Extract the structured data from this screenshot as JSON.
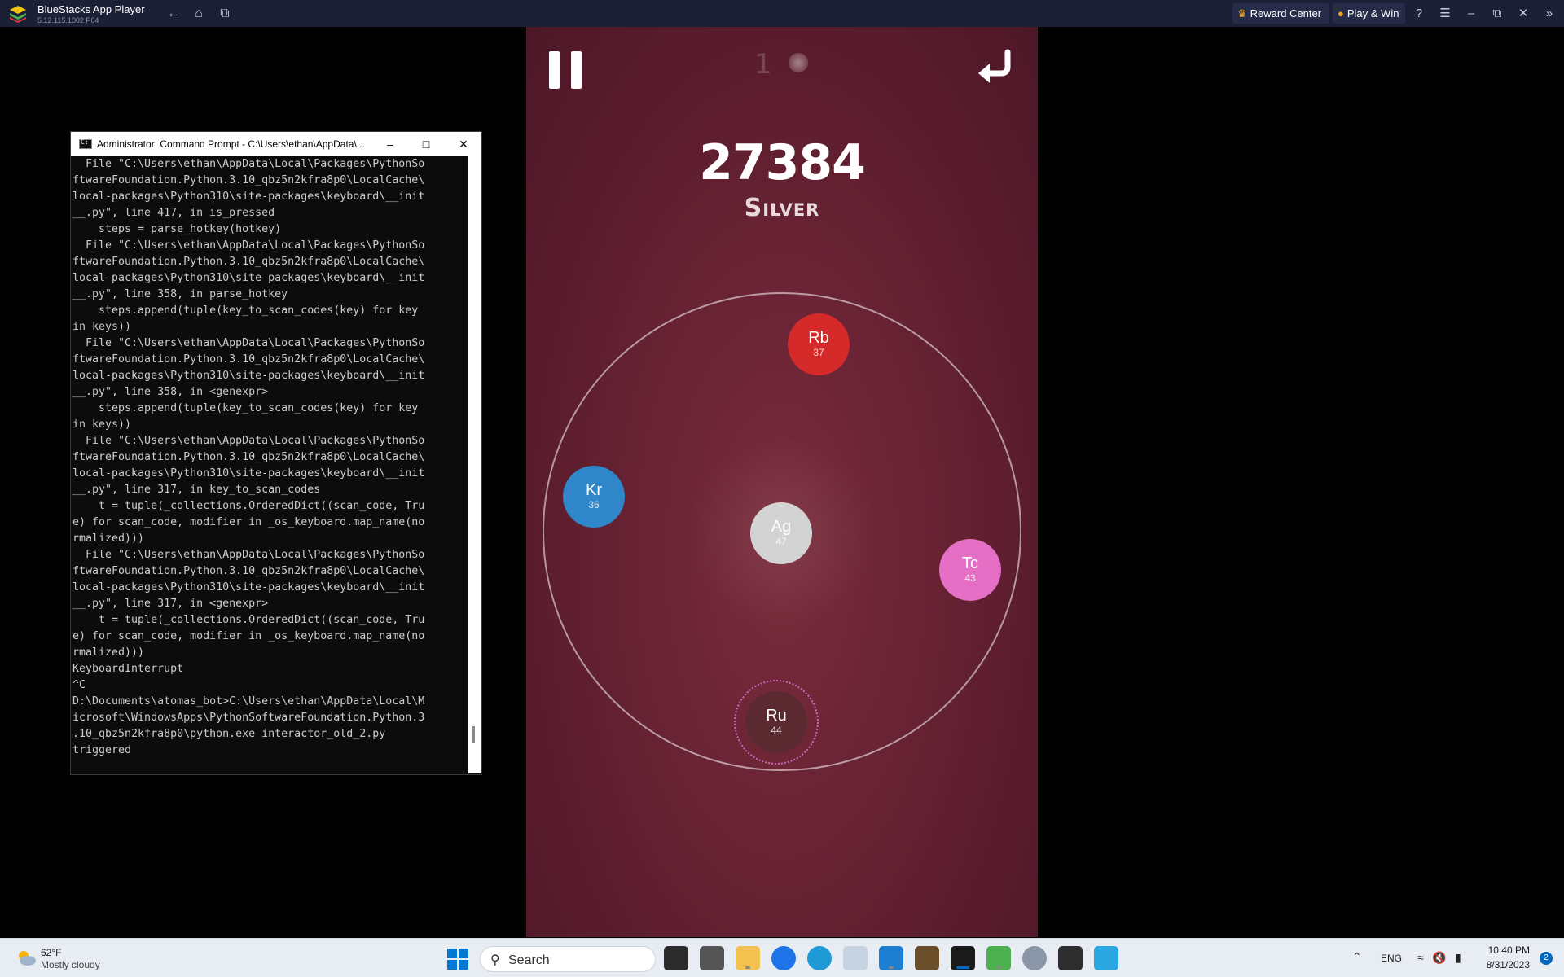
{
  "titlebar": {
    "app_title": "BlueStacks App Player",
    "version": "5.12.115.1002 P64",
    "reward_center": "Reward Center",
    "play_win": "Play & Win"
  },
  "game": {
    "level": "1",
    "score": "27384",
    "rank": "Silver",
    "atoms": [
      {
        "symbol": "Rb",
        "number": "37",
        "color": "#d42a2a"
      },
      {
        "symbol": "Kr",
        "number": "36",
        "color": "#2f86c8"
      },
      {
        "symbol": "Ag",
        "number": "47",
        "color": "#d3d3d3"
      },
      {
        "symbol": "Tc",
        "number": "43",
        "color": "#e56fc4"
      },
      {
        "symbol": "Ru",
        "number": "44",
        "color": "#5b2a30"
      }
    ]
  },
  "cmd": {
    "title": "Administrator: Command Prompt - C:\\Users\\ethan\\AppData\\...",
    "output": "  File \"C:\\Users\\ethan\\AppData\\Local\\Packages\\PythonSo\nftwareFoundation.Python.3.10_qbz5n2kfra8p0\\LocalCache\\\nlocal-packages\\Python310\\site-packages\\keyboard\\__init\n__.py\", line 417, in is_pressed\n    steps = parse_hotkey(hotkey)\n  File \"C:\\Users\\ethan\\AppData\\Local\\Packages\\PythonSo\nftwareFoundation.Python.3.10_qbz5n2kfra8p0\\LocalCache\\\nlocal-packages\\Python310\\site-packages\\keyboard\\__init\n__.py\", line 358, in parse_hotkey\n    steps.append(tuple(key_to_scan_codes(key) for key\nin keys))\n  File \"C:\\Users\\ethan\\AppData\\Local\\Packages\\PythonSo\nftwareFoundation.Python.3.10_qbz5n2kfra8p0\\LocalCache\\\nlocal-packages\\Python310\\site-packages\\keyboard\\__init\n__.py\", line 358, in <genexpr>\n    steps.append(tuple(key_to_scan_codes(key) for key\nin keys))\n  File \"C:\\Users\\ethan\\AppData\\Local\\Packages\\PythonSo\nftwareFoundation.Python.3.10_qbz5n2kfra8p0\\LocalCache\\\nlocal-packages\\Python310\\site-packages\\keyboard\\__init\n__.py\", line 317, in key_to_scan_codes\n    t = tuple(_collections.OrderedDict((scan_code, Tru\ne) for scan_code, modifier in _os_keyboard.map_name(no\nrmalized)))\n  File \"C:\\Users\\ethan\\AppData\\Local\\Packages\\PythonSo\nftwareFoundation.Python.3.10_qbz5n2kfra8p0\\LocalCache\\\nlocal-packages\\Python310\\site-packages\\keyboard\\__init\n__.py\", line 317, in <genexpr>\n    t = tuple(_collections.OrderedDict((scan_code, Tru\ne) for scan_code, modifier in _os_keyboard.map_name(no\nrmalized)))\nKeyboardInterrupt\n^C\nD:\\Documents\\atomas_bot>C:\\Users\\ethan\\AppData\\Local\\M\nicrosoft\\WindowsApps\\PythonSoftwareFoundation.Python.3\n.10_qbz5n2kfra8p0\\python.exe interactor_old_2.py\ntriggered"
  },
  "taskbar": {
    "weather_temp": "62°F",
    "weather_desc": "Mostly cloudy",
    "search_label": "Search",
    "language": "ENG",
    "time": "10:40 PM",
    "date": "8/31/2023",
    "notification_count": "2"
  }
}
